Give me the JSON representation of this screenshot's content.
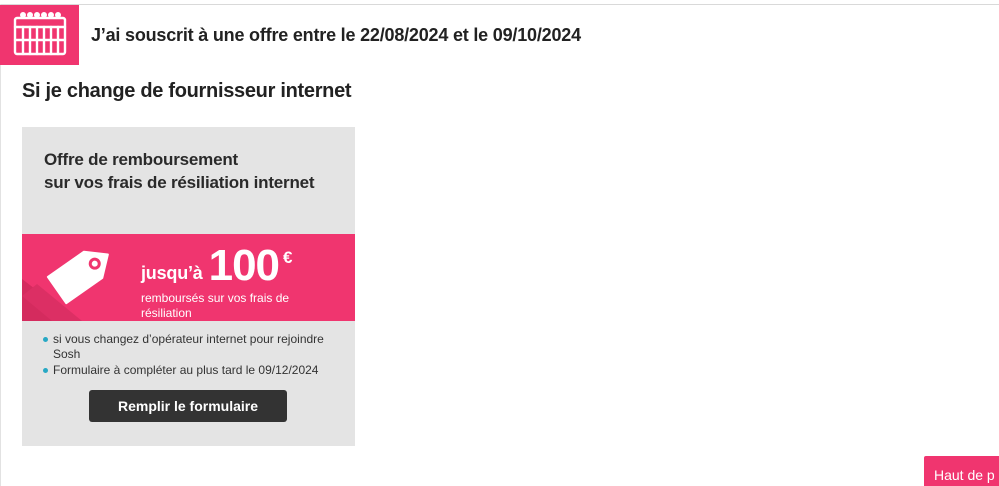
{
  "header": {
    "title": "J’ai souscrit à une offre entre le 22/08/2024 et le 09/10/2024",
    "icon": "calendar-icon",
    "accent_color": "#f0356f"
  },
  "section": {
    "title": "Si je change de fournisseur internet"
  },
  "offer_card": {
    "title_line1": "Offre de remboursement",
    "title_line2": "sur vos frais de résiliation internet",
    "banner": {
      "icon": "price-tag-icon",
      "prefix": "jusqu’à",
      "amount": "100",
      "currency": "€",
      "subtitle": "remboursés sur vos frais de résiliation"
    },
    "bullets": [
      "si vous changez d’opérateur internet pour rejoindre Sosh",
      "Formulaire à compléter au plus tard le 09/12/2024"
    ],
    "bullet_color": "#27a8c4",
    "cta_label": "Remplir le formulaire"
  },
  "back_to_top": {
    "label": "Haut de p"
  }
}
